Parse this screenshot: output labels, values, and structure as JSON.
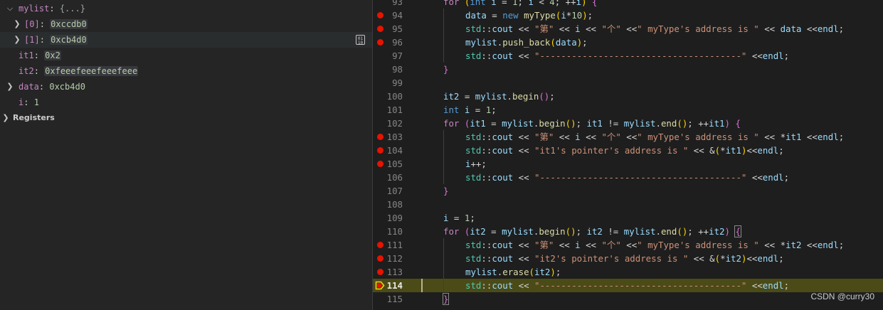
{
  "variables": {
    "mylist": {
      "name": "mylist",
      "value": "{...}"
    },
    "items": [
      {
        "name": "[0]",
        "value": "0xccdb0"
      },
      {
        "name": "[1]",
        "value": "0xcb4d0"
      }
    ],
    "it1": {
      "name": "it1",
      "value": "0x2"
    },
    "it2": {
      "name": "it2",
      "value": "0xfeeefeeefeeefeee"
    },
    "data": {
      "name": "data",
      "value": "0xcb4d0"
    },
    "i": {
      "name": "i",
      "value": "1"
    },
    "registers_label": "Registers",
    "view_binary_icon": "binary-data-icon"
  },
  "editor": {
    "current_line": 114,
    "lines": [
      {
        "n": 93,
        "bp": false
      },
      {
        "n": 94,
        "bp": true
      },
      {
        "n": 95,
        "bp": true
      },
      {
        "n": 96,
        "bp": true
      },
      {
        "n": 97,
        "bp": false
      },
      {
        "n": 98,
        "bp": false
      },
      {
        "n": 99,
        "bp": false
      },
      {
        "n": 100,
        "bp": false
      },
      {
        "n": 101,
        "bp": false
      },
      {
        "n": 102,
        "bp": false
      },
      {
        "n": 103,
        "bp": true
      },
      {
        "n": 104,
        "bp": true
      },
      {
        "n": 105,
        "bp": true
      },
      {
        "n": 106,
        "bp": false
      },
      {
        "n": 107,
        "bp": false
      },
      {
        "n": 108,
        "bp": false
      },
      {
        "n": 109,
        "bp": false
      },
      {
        "n": 110,
        "bp": false
      },
      {
        "n": 111,
        "bp": true
      },
      {
        "n": 112,
        "bp": true
      },
      {
        "n": 113,
        "bp": true
      },
      {
        "n": 114,
        "bp": true
      },
      {
        "n": 115,
        "bp": false
      }
    ],
    "code": {
      "l93": "for (int i = 1; i < 4; ++i) {",
      "l94": "data = new myType(i*10);",
      "l95": "std::cout << \"第\" << i << \"个\" <<\" myType's address is \" << data <<endl;",
      "l96": "mylist.push_back(data);",
      "l97": "std::cout << \"--------------------------------------\" <<endl;",
      "l98": "}",
      "l99": "",
      "l100": "it2 = mylist.begin();",
      "l101": "int i = 1;",
      "l102": "for (it1 = mylist.begin(); it1 != mylist.end(); ++it1) {",
      "l103": "std::cout << \"第\" << i << \"个\" <<\" myType's address is \" << *it1 <<endl;",
      "l104": "std::cout << \"it1's pointer's address is \" << &(*it1)<<endl;",
      "l105": "i++;",
      "l106": "std::cout << \"--------------------------------------\" <<endl;",
      "l107": "}",
      "l108": "",
      "l109": "i = 1;",
      "l110": "for (it2 = mylist.begin(); it2 != mylist.end(); ++it2) {",
      "l111": "std::cout << \"第\" << i << \"个\" <<\" myType's address is \" << *it2 <<endl;",
      "l112": "std::cout << \"it2's pointer's address is \" << &(*it2)<<endl;",
      "l113": "mylist.erase(it2);",
      "l114": "std::cout << \"--------------------------------------\" <<endl;",
      "l115": "}"
    }
  },
  "watermark": "CSDN @curry30",
  "colors": {
    "breakpoint": "#e51400",
    "current_line": "#4b4b18",
    "keyword": "#569cd6",
    "string": "#ce9178",
    "type": "#4ec9b0",
    "variable": "#9cdcfe",
    "function": "#dcdcaa"
  }
}
